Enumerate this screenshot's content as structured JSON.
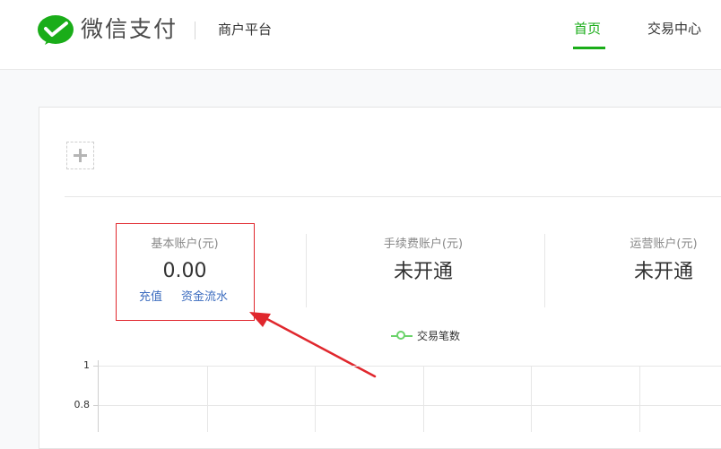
{
  "header": {
    "brand": "微信支付",
    "subbrand": "商户平台",
    "nav": [
      {
        "label": "首页",
        "active": true
      },
      {
        "label": "交易中心",
        "active": false
      }
    ],
    "accent_color": "#1aad19"
  },
  "accounts": [
    {
      "title": "基本账户(元)",
      "value": "0.00",
      "links": [
        "充值",
        "资金流水"
      ]
    },
    {
      "title": "手续费账户(元)",
      "value": "未开通"
    },
    {
      "title": "运营账户(元)",
      "value": "未开通"
    }
  ],
  "annotation_color": "#e0272d",
  "chart_data": {
    "type": "line",
    "series": [
      {
        "name": "交易笔数",
        "values": []
      }
    ],
    "y_ticks": [
      "1",
      "0.8"
    ],
    "ylim": [
      0,
      1
    ],
    "grid": true,
    "legend_placement": "top-center"
  }
}
